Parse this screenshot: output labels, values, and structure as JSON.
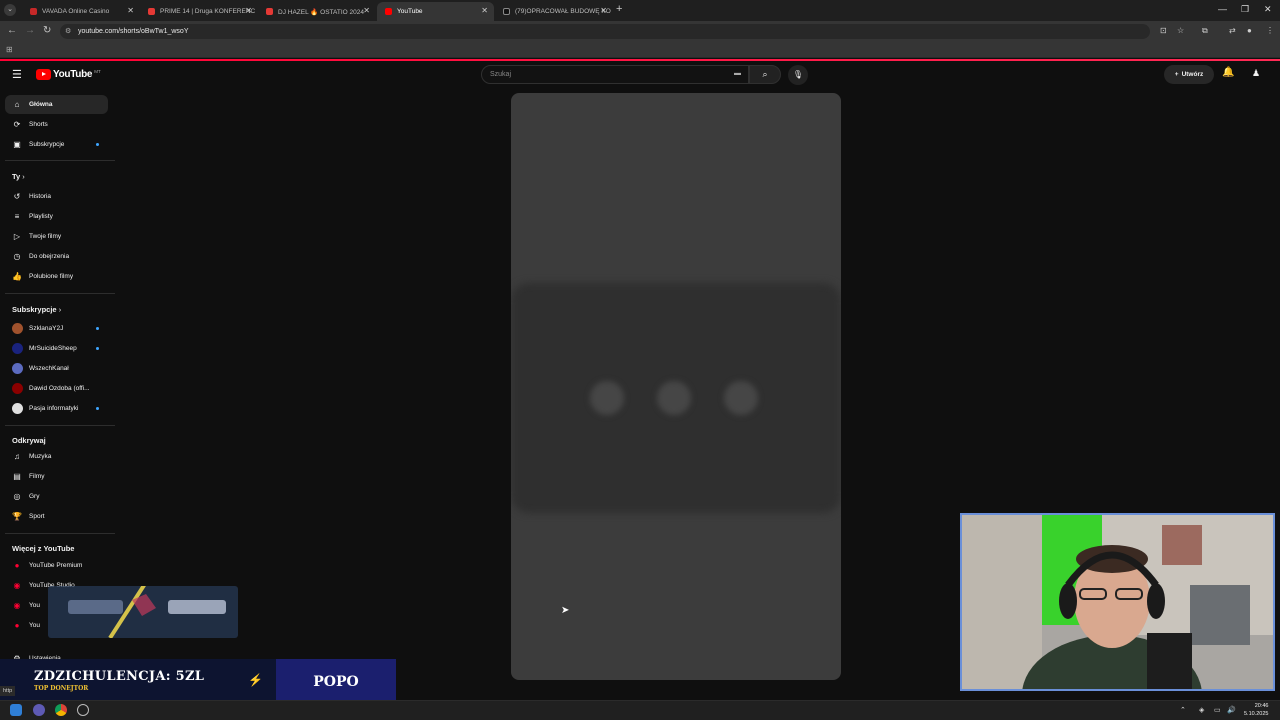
{
  "browser": {
    "tabs": [
      {
        "label": "VAVADA Online Casino",
        "fav": "#c62828"
      },
      {
        "label": "PRIME 14 | Druga KONFERENC",
        "fav": "#e53935"
      },
      {
        "label": "DJ HAZEL 🔥 OSTATIO 2024 🔥 |",
        "fav": "#e53935"
      },
      {
        "label": "YouTube",
        "fav": "#ff0000"
      },
      {
        "label": "(79)OPRACOWAŁ BUDOWĘ KO",
        "fav": "#111111"
      }
    ],
    "url": "youtube.com/shorts/oBwTw1_wsoY",
    "status_url": "http"
  },
  "youtube": {
    "logo_text": "YouTube",
    "country_code": "MT",
    "search_placeholder": "Szukaj",
    "create_label": "Utwórz"
  },
  "sidebar": {
    "main": [
      {
        "label": "Główna",
        "icon": "home-icon",
        "glyph": "⌂"
      },
      {
        "label": "Shorts",
        "icon": "shorts-icon",
        "glyph": "⟳"
      },
      {
        "label": "Subskrypcje",
        "icon": "subscriptions-icon",
        "glyph": "▣"
      }
    ],
    "you_header": "Ty",
    "you": [
      {
        "label": "Historia",
        "icon": "history-icon",
        "glyph": "↺"
      },
      {
        "label": "Playlisty",
        "icon": "playlists-icon",
        "glyph": "≡"
      },
      {
        "label": "Twoje filmy",
        "icon": "your-videos-icon",
        "glyph": "▷"
      },
      {
        "label": "Do obejrzenia",
        "icon": "watch-later-icon",
        "glyph": "◷"
      },
      {
        "label": "Polubione filmy",
        "icon": "liked-icon",
        "glyph": "👍"
      }
    ],
    "subs_header": "Subskrypcje",
    "subs": [
      {
        "label": "SzklanaY2J",
        "color": "#a0522d"
      },
      {
        "label": "MrSuicideSheep",
        "color": "#1a237e"
      },
      {
        "label": "WszechKanał",
        "color": "#5c6bc0"
      },
      {
        "label": "Dawid Ozdoba (offi...",
        "color": "#8b0000"
      },
      {
        "label": "Pasja informatyki",
        "color": "#e0e0e0"
      }
    ],
    "explore_header": "Odkrywaj",
    "explore": [
      {
        "label": "Muzyka",
        "icon": "music-icon",
        "glyph": "♫"
      },
      {
        "label": "Filmy",
        "icon": "movies-icon",
        "glyph": "▤"
      },
      {
        "label": "Gry",
        "icon": "gaming-icon",
        "glyph": "◎"
      },
      {
        "label": "Sport",
        "icon": "sport-icon",
        "glyph": "🏆"
      }
    ],
    "more_header": "Więcej z YouTube",
    "more": [
      {
        "label": "YouTube Premium"
      },
      {
        "label": "YouTube Studio"
      },
      {
        "label": "You"
      },
      {
        "label": "You"
      }
    ],
    "settings_label": "Ustawienia"
  },
  "overlay": {
    "donation_title": "ZDZICHULENCJA: 5ZL",
    "donation_sub": "TOP DONEJTOR",
    "donor_name": "POPO"
  },
  "taskbar": {
    "time": "20:46",
    "date": "5.10.2025"
  }
}
